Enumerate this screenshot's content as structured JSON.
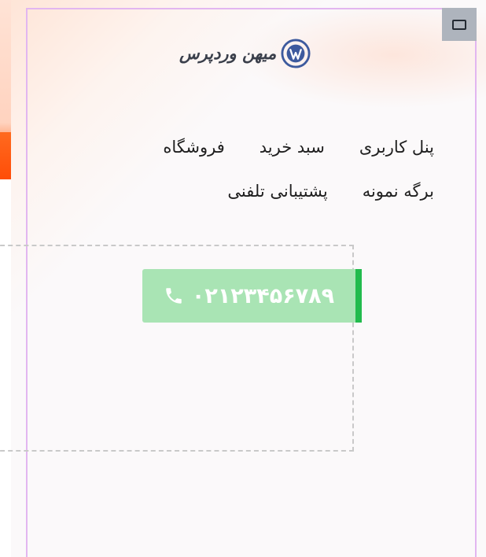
{
  "header": {
    "logo": {
      "wordmark": "میهن وردپرس",
      "emblem": "wordpress-logo-icon"
    },
    "view_toggle_icon": "window-icon"
  },
  "nav": {
    "items": [
      {
        "label": "پنل کاربری"
      },
      {
        "label": "سبد خرید"
      },
      {
        "label": "فروشگاه"
      },
      {
        "label": "برگه نمونه"
      },
      {
        "label": "پشتیبانی تلفنی"
      }
    ]
  },
  "phone_button": {
    "number": "۰۲۱۲۳۴۵۶۷۸۹",
    "icon": "phone-icon",
    "background_color": "#a9e4b4",
    "accent_color": "#22bb4d"
  },
  "colors": {
    "frame_border": "#e2b6f0",
    "left_accent": "#ff5a12"
  }
}
